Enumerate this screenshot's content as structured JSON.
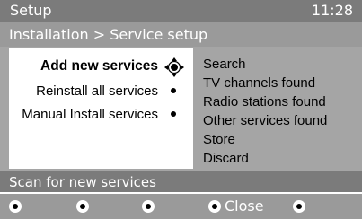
{
  "header": {
    "title": "Setup",
    "time": "11:28"
  },
  "breadcrumb": "Installation > Service setup",
  "menu": {
    "items": [
      {
        "label": "Add new services",
        "selected": true
      },
      {
        "label": "Reinstall all services",
        "selected": false
      },
      {
        "label": "Manual Install services",
        "selected": false
      }
    ]
  },
  "submenu": {
    "items": [
      "Search",
      "TV channels found",
      "Radio stations found",
      "Other services found",
      "Store",
      "Discard"
    ]
  },
  "hint": "Scan for new services",
  "footer": {
    "close_label": "Close"
  },
  "colors": {
    "title_bar": "#7b7b7b",
    "crumb_bar": "#9a9a9a",
    "panel_grey": "#a5a5a5",
    "highlight": "#ffffff"
  }
}
